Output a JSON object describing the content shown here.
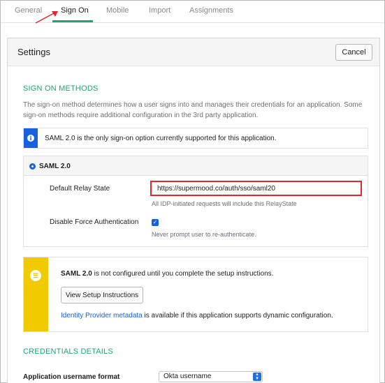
{
  "tabs": [
    "General",
    "Sign On",
    "Mobile",
    "Import",
    "Assignments"
  ],
  "settings": {
    "title": "Settings",
    "cancel_label": "Cancel"
  },
  "sign_on": {
    "section_title": "SIGN ON METHODS",
    "description": "The sign-on method determines how a user signs into and manages their credentials for an application. Some sign-on methods require additional configuration in the 3rd party application.",
    "info_text": "SAML 2.0 is the only sign-on option currently supported for this application.",
    "saml_title": "SAML 2.0",
    "relay_label": "Default Relay State",
    "relay_value": "https://supermood.co/auth/sso/saml20",
    "relay_hint": "All IDP-initiated requests will include this RelayState",
    "force_auth_label": "Disable Force Authentication",
    "force_auth_checked": true,
    "force_auth_hint": "Never prompt user to re-authenticate."
  },
  "setup": {
    "saml_bold": "SAML 2.0",
    "notice": " is not configured until you complete the setup instructions.",
    "button_label": "View Setup Instructions",
    "idp_link": "Identity Provider metadata",
    "idp_text": " is available if this application supports dynamic configuration."
  },
  "credentials": {
    "section_title": "CREDENTIALS DETAILS",
    "username_format_label": "Application username format",
    "username_format_value": "Okta username"
  },
  "colors": {
    "accent": "#21a37a",
    "info": "#1662dd",
    "warning": "#f2ca00",
    "highlight": "#e2262b"
  },
  "icons": [
    "info-icon",
    "list-icon",
    "checkbox-check-icon",
    "select-arrows-icon",
    "red-arrow-annotation"
  ]
}
